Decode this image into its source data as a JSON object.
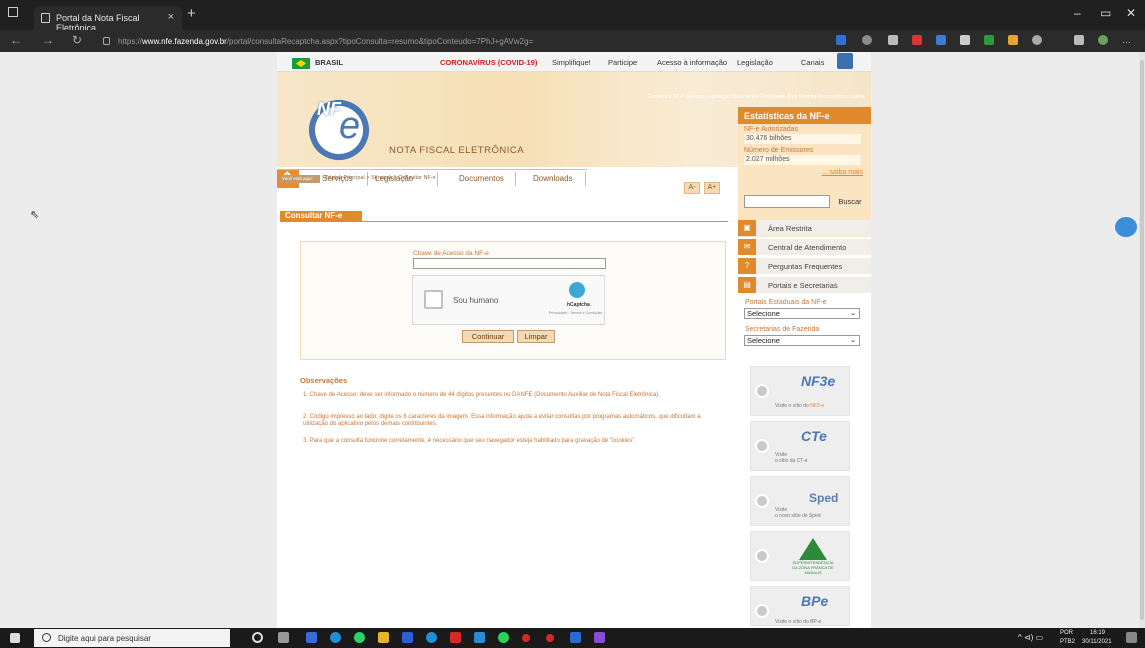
{
  "browser": {
    "tab_title": "Portal da Nota Fiscal Eletrônica",
    "tab_close": "×",
    "new_tab": "+",
    "url_prefix": "https://",
    "url_host": "www.nfe.fazenda.gov.br",
    "url_path": "/portal/consultaRecaptcha.aspx?tipoConsulta=resumo&tipoConteudo=7PhJ+gAVw2g=",
    "minimize": "–",
    "maximize": "▭",
    "close": "✕"
  },
  "gov_bar": {
    "brasil": "BRASIL",
    "covid": "CORONAVÍRUS (COVID-19)",
    "simplifique": "Simplifique!",
    "participe": "Participe",
    "acesso": "Acesso à informação",
    "legislacao": "Legislação",
    "canais": "Canais"
  },
  "header": {
    "toplinks": "Conheça o NF-e   Serviços   Legislação   Documentos   Downloads   Área Restrita   Documentos e outros",
    "logo_text": "NF",
    "logo_letter": "e",
    "title": "NOTA FISCAL ELETRÔNICA",
    "nav": [
      "Serviços",
      "Legislação",
      "Documentos",
      "Downloads"
    ]
  },
  "stats": {
    "heading": "Estatísticas da NF-e",
    "label1": "NF-e Autorizadas",
    "value1": "30.476 bilhões",
    "label2": "Número de Emissores",
    "value2": "2.027 milhões",
    "more": "... saiba mais"
  },
  "breadcrumb": {
    "voce": "Você está aqui:",
    "path": "Página Principal > Serviços > Consultar NF-e"
  },
  "font_controls": {
    "smaller": "A-",
    "larger": "A+"
  },
  "search": {
    "button": "Buscar"
  },
  "sidebar": {
    "items": [
      {
        "icon": "lock-icon",
        "label": "Área Restrita"
      },
      {
        "icon": "envelope-icon",
        "label": "Central de Atendimento"
      },
      {
        "icon": "question-icon",
        "label": "Perguntas Frequentes"
      },
      {
        "icon": "portal-icon",
        "label": "Portais e Secretarias"
      }
    ],
    "portais_label": "Portais Estaduais da NF-e",
    "portais_value": "Selecione",
    "secretarias_label": "Secretarias de Fazenda",
    "secretarias_value": "Selecione",
    "promos": [
      {
        "brand": "NF3e",
        "line1": "Visite o sítio do",
        "line2": "NF3-e"
      },
      {
        "brand": "CTe",
        "line1": "Visite",
        "line2": "o sítio da CT-e"
      },
      {
        "brand": "Sped",
        "line1": "Visite",
        "line2": "o novo sítio do Sped"
      },
      {
        "brand": "SUFRAMA",
        "line1": "SUPERINTENDÊNCIA DA ZONA FRANCA DE MANAUS",
        "line2": ""
      },
      {
        "brand": "BPe",
        "line1": "Visite o sítio do BP-e",
        "line2": ""
      }
    ]
  },
  "consultar": {
    "heading": "Consultar NF-e",
    "chave_label": "Chave de Acesso da NF-e",
    "chave_value": "",
    "captcha_text": "Sou humano",
    "captcha_brand": "hCaptcha",
    "captcha_links": "Privacidade - Termos e Condições",
    "continuar": "Continuar",
    "limpar": "Limpar"
  },
  "observacoes": {
    "heading": "Observações",
    "items": [
      "1. Chave de Acesso: deve ser informado o número de 44 dígitos presentes no DANFE (Documento Auxiliar de Nota Fiscal Eletrônica).",
      "2. Código impresso ao lado: digite os 6 caracteres da imagem. Essa informação ajuda a evitar consultas por programas automáticos, que dificultam a utilização do aplicativo pelos demais contribuintes.",
      "3. Para que a consulta funcione corretamente, é necessário que seu navegador esteja habilitado para gravação de \"cookies\"."
    ]
  },
  "taskbar": {
    "search_placeholder": "Digite aqui para pesquisar",
    "lang": "POR",
    "layout": "PTB2",
    "time": "16:19",
    "date": "30/11/2021"
  },
  "colors": {
    "accent": "#e08a2c",
    "text_orange": "#c4773a",
    "brown": "#8a5a2a"
  }
}
